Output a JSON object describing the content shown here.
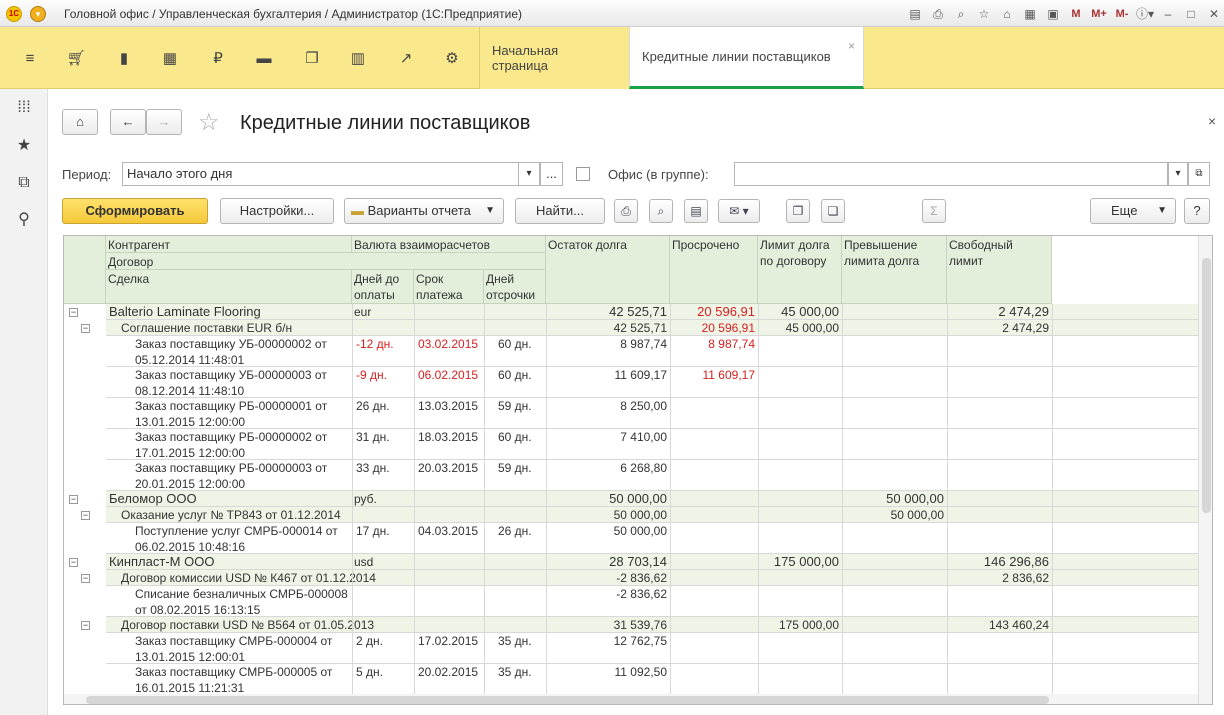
{
  "window": {
    "title": "Головной офис / Управленческая бухгалтерия / Администратор  (1С:Предприятие)",
    "logo_text": "1С",
    "toolbar_m": [
      "M",
      "M+",
      "M-"
    ]
  },
  "tabs": [
    {
      "label": "Начальная страница"
    },
    {
      "label": "Кредитные линии поставщиков",
      "close": "×"
    }
  ],
  "page": {
    "title": "Кредитные линии поставщиков",
    "close": "×"
  },
  "filters": {
    "period_label": "Период:",
    "period_value": "Начало этого дня",
    "period_more": "...",
    "office_label": "Офис (в группе):",
    "office_value": ""
  },
  "toolbar": {
    "generate": "Сформировать",
    "settings": "Настройки...",
    "variants": "Варианты отчета",
    "find": "Найти...",
    "more": "Еще",
    "help": "?",
    "sum": "Σ"
  },
  "headers": {
    "counterparty": "Контрагент",
    "currency": "Валюта взаиморасчетов",
    "balance": "Остаток долга",
    "overdue": "Просрочено",
    "limit": "Лимит долга по договору",
    "excess": "Превышение лимита долга",
    "free": "Свободный лимит",
    "contract": "Договор",
    "deal": "Сделка",
    "days_to_pay": "Дней до оплаты",
    "due_date": "Срок платежа",
    "deferral": "Дней отсрочки"
  },
  "rows": [
    {
      "level": 0,
      "name": "Balterio Laminate Flooring",
      "currency": "eur",
      "balance": "42 525,71",
      "overdue": "20 596,91",
      "limit": "45 000,00",
      "excess": "",
      "free": "2 474,29"
    },
    {
      "level": 1,
      "name": "Соглашение поставки EUR б/н",
      "balance": "42 525,71",
      "overdue": "20 596,91",
      "limit": "45 000,00",
      "excess": "",
      "free": "2 474,29"
    },
    {
      "level": 2,
      "name": "Заказ поставщику УБ-00000002 от 05.12.2014 11:48:01",
      "days": "-12 дн.",
      "due": "03.02.2015",
      "deferral": "60 дн.",
      "balance": "8 987,74",
      "overdue": "8 987,74",
      "red": true
    },
    {
      "level": 2,
      "name": "Заказ поставщику УБ-00000003 от 08.12.2014 11:48:10",
      "days": "-9 дн.",
      "due": "06.02.2015",
      "deferral": "60 дн.",
      "balance": "11 609,17",
      "overdue": "11 609,17",
      "red": true
    },
    {
      "level": 2,
      "name": "Заказ поставщику РБ-00000001 от 13.01.2015 12:00:00",
      "days": "26 дн.",
      "due": "13.03.2015",
      "deferral": "59 дн.",
      "balance": "8 250,00",
      "overdue": ""
    },
    {
      "level": 2,
      "name": "Заказ поставщику РБ-00000002 от 17.01.2015 12:00:00",
      "days": "31 дн.",
      "due": "18.03.2015",
      "deferral": "60 дн.",
      "balance": "7 410,00",
      "overdue": ""
    },
    {
      "level": 2,
      "name": "Заказ поставщику РБ-00000003 от 20.01.2015 12:00:00",
      "days": "33 дн.",
      "due": "20.03.2015",
      "deferral": "59 дн.",
      "balance": "6 268,80",
      "overdue": ""
    },
    {
      "level": 0,
      "name": "Беломор ООО",
      "currency": "руб.",
      "balance": "50 000,00",
      "overdue": "",
      "limit": "",
      "excess": "50 000,00",
      "free": ""
    },
    {
      "level": 1,
      "name": "Оказание услуг № ТР843 от 01.12.2014",
      "balance": "50 000,00",
      "overdue": "",
      "limit": "",
      "excess": "50 000,00",
      "free": ""
    },
    {
      "level": 2,
      "name": "Поступление услуг СМРБ-000014 от 06.02.2015 10:48:16",
      "days": "17 дн.",
      "due": "04.03.2015",
      "deferral": "26 дн.",
      "balance": "50 000,00",
      "overdue": ""
    },
    {
      "level": 0,
      "name": "Кинпласт-М ООО",
      "currency": "usd",
      "balance": "28 703,14",
      "overdue": "",
      "limit": "175 000,00",
      "excess": "",
      "free": "146 296,86"
    },
    {
      "level": 1,
      "name": "Договор комиссии USD № К467 от 01.12.2014",
      "balance": "-2 836,62",
      "overdue": "",
      "limit": "",
      "excess": "",
      "free": "2 836,62"
    },
    {
      "level": 2,
      "name": "Списание безналичных СМРБ-000008 от 08.02.2015 16:13:15",
      "days": "",
      "due": "",
      "deferral": "",
      "balance": "-2 836,62",
      "overdue": ""
    },
    {
      "level": 1,
      "name": "Договор поставки USD № В564 от 01.05.2013",
      "balance": "31 539,76",
      "overdue": "",
      "limit": "175 000,00",
      "excess": "",
      "free": "143 460,24"
    },
    {
      "level": 2,
      "name": "Заказ поставщику СМРБ-000004 от 13.01.2015 12:00:01",
      "days": "2 дн.",
      "due": "17.02.2015",
      "deferral": "35 дн.",
      "balance": "12 762,75",
      "overdue": ""
    },
    {
      "level": 2,
      "name": "Заказ поставщику СМРБ-000005 от 16.01.2015 11:21:31",
      "days": "5 дн.",
      "due": "20.02.2015",
      "deferral": "35 дн.",
      "balance": "11 092,50",
      "overdue": ""
    }
  ]
}
